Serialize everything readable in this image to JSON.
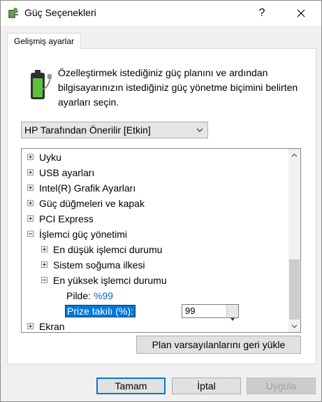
{
  "window": {
    "title": "Güç Seçenekleri",
    "help_glyph": "?",
    "close_glyph": "✕"
  },
  "tab": {
    "label": "Gelişmiş ayarlar"
  },
  "description": "Özelleştirmek istediğiniz güç planını ve ardından bilgisayarınızın istediğiniz güç yönetme biçimini belirten ayarları seçin.",
  "plan_select": {
    "selected": "HP Tarafından Önerilir [Etkin]"
  },
  "tree": {
    "items": [
      {
        "label": "Uyku",
        "expanded": false
      },
      {
        "label": "USB ayarları",
        "expanded": false
      },
      {
        "label": "Intel(R) Grafik Ayarları",
        "expanded": false
      },
      {
        "label": "Güç düğmeleri ve kapak",
        "expanded": false
      },
      {
        "label": "PCI Express",
        "expanded": false
      },
      {
        "label": "İşlemci güç yönetimi",
        "expanded": true
      },
      {
        "label": "En düşük işlemci durumu",
        "expanded": false
      },
      {
        "label": "Sistem soğuma ilkesi",
        "expanded": false
      },
      {
        "label": "En yüksek işlemci durumu",
        "expanded": true
      },
      {
        "label": "Ekran",
        "expanded": false
      }
    ],
    "on_battery": {
      "label": "Pilde:",
      "value": "%99"
    },
    "plugged_in": {
      "label": "Prize takılı (%):",
      "value": "99"
    }
  },
  "restore_button": "Plan varsayılanlarını geri yükle",
  "buttons": {
    "ok": "Tamam",
    "cancel": "İptal",
    "apply": "Uygula"
  },
  "colors": {
    "accent": "#0078d7",
    "value_link": "#0066cc"
  }
}
